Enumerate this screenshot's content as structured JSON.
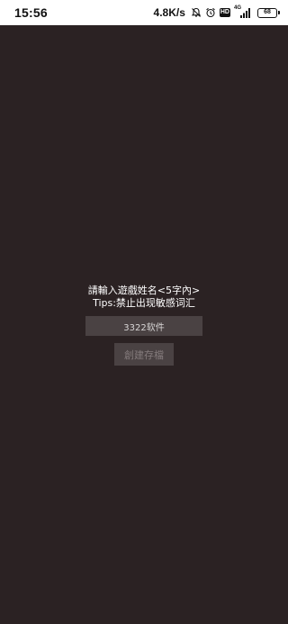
{
  "status_bar": {
    "time": "15:56",
    "net_speed": "4.8K/s",
    "hd_label": "HD",
    "signal_label": "4G",
    "battery_level": "68"
  },
  "dialog": {
    "prompt_line1": "請輸入遊戲姓名<5字內>",
    "prompt_line2": "Tips:禁止出现敏感词汇",
    "name_value": "3322软件",
    "create_label": "創建存檔"
  },
  "colors": {
    "background": "#2b2223",
    "status_bar": "#ffffff",
    "control_bg": "#4a4243",
    "disabled_text": "#847b7c"
  }
}
